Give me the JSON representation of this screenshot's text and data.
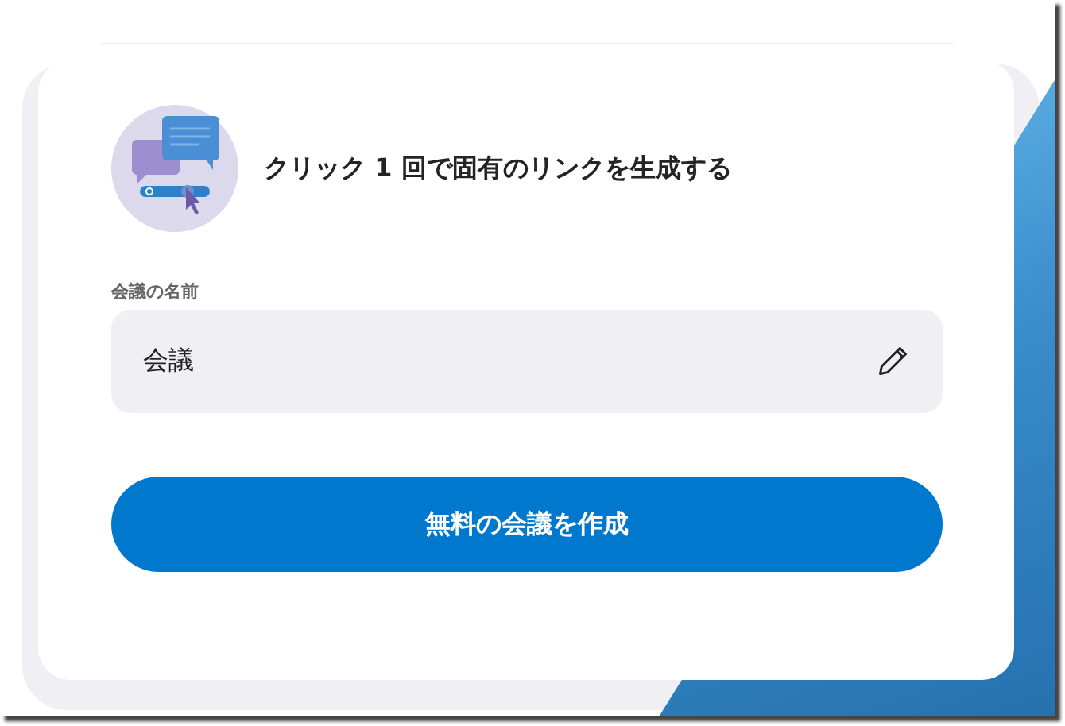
{
  "headline": "クリック 1 回で固有のリンクを生成する",
  "meeting_name": {
    "label": "会議の名前",
    "value": "会議"
  },
  "create_button": "無料の会議を作成"
}
